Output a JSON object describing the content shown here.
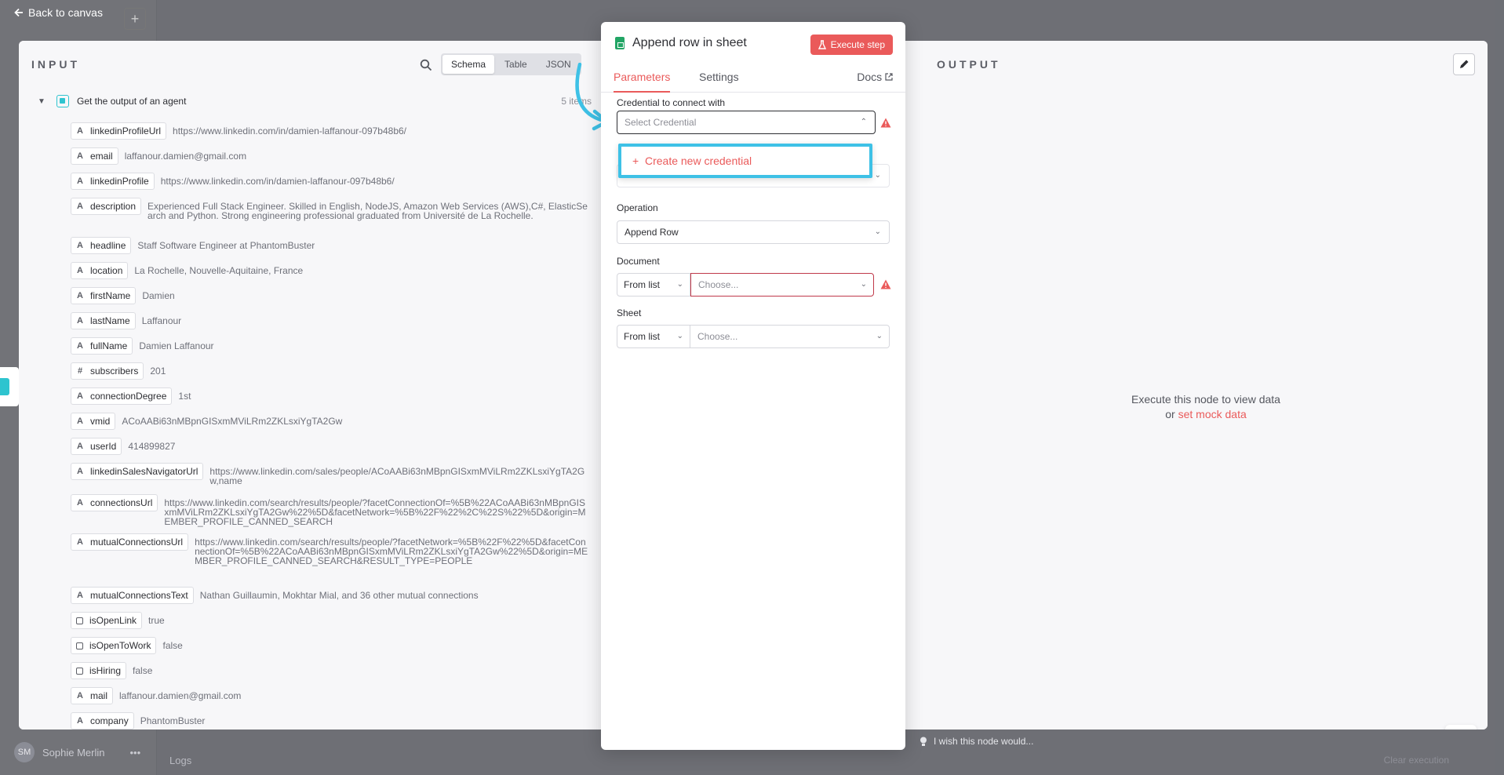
{
  "backdrop": {
    "back_label": "Back to canvas",
    "add_label": "+",
    "user_initials": "SM",
    "user_name": "Sophie Merlin",
    "user_menu": "•••",
    "logs_label": "Logs",
    "clear_label": "Clear execution",
    "wish_label": "I wish this node would..."
  },
  "input": {
    "title": "INPUT",
    "view_modes": [
      "Schema",
      "Table",
      "JSON"
    ],
    "active_mode": "Schema",
    "group_title": "Get the output of an agent",
    "group_count": "5 items",
    "fields": [
      {
        "type": "A",
        "key": "linkedinProfileUrl",
        "value": "https://www.linkedin.com/in/damien-laffanour-097b48b6/"
      },
      {
        "type": "A",
        "key": "email",
        "value": "laffanour.damien@gmail.com"
      },
      {
        "type": "A",
        "key": "linkedinProfile",
        "value": "https://www.linkedin.com/in/damien-laffanour-097b48b6/"
      },
      {
        "type": "A",
        "key": "description",
        "value": "Experienced Full Stack Engineer. Skilled in English, NodeJS, Amazon Web Services (AWS),C#, ElasticSearch and Python. Strong engineering professional graduated from Université de La Rochelle."
      },
      {
        "type": "A",
        "key": "headline",
        "value": "Staff Software Engineer at PhantomBuster"
      },
      {
        "type": "A",
        "key": "location",
        "value": "La Rochelle, Nouvelle-Aquitaine, France"
      },
      {
        "type": "A",
        "key": "firstName",
        "value": "Damien"
      },
      {
        "type": "A",
        "key": "lastName",
        "value": "Laffanour"
      },
      {
        "type": "A",
        "key": "fullName",
        "value": "Damien Laffanour"
      },
      {
        "type": "#",
        "key": "subscribers",
        "value": "201"
      },
      {
        "type": "A",
        "key": "connectionDegree",
        "value": "1st"
      },
      {
        "type": "A",
        "key": "vmid",
        "value": "ACoAABi63nMBpnGISxmMViLRm2ZKLsxiYgTA2Gw"
      },
      {
        "type": "A",
        "key": "userId",
        "value": "414899827"
      },
      {
        "type": "A",
        "key": "linkedinSalesNavigatorUrl",
        "value": "https://www.linkedin.com/sales/people/ACoAABi63nMBpnGISxmMViLRm2ZKLsxiYgTA2Gw,name"
      },
      {
        "type": "A",
        "key": "connectionsUrl",
        "value": "https://www.linkedin.com/search/results/people/?facetConnectionOf=%5B%22ACoAABi63nMBpnGISxmMViLRm2ZKLsxiYgTA2Gw%22%5D&facetNetwork=%5B%22F%22%2C%22S%22%5D&origin=MEMBER_PROFILE_CANNED_SEARCH"
      },
      {
        "type": "A",
        "key": "mutualConnectionsUrl",
        "value": "https://www.linkedin.com/search/results/people/?facetNetwork=%5B%22F%22%5D&facetConnectionOf=%5B%22ACoAABi63nMBpnGISxmMViLRm2ZKLsxiYgTA2Gw%22%5D&origin=MEMBER_PROFILE_CANNED_SEARCH&RESULT_TYPE=PEOPLE"
      },
      {
        "type": "A",
        "key": "mutualConnectionsText",
        "value": "Nathan Guillaumin, Mokhtar Mial, and 36 other mutual connections"
      },
      {
        "type": "check",
        "key": "isOpenLink",
        "value": "true"
      },
      {
        "type": "check",
        "key": "isOpenToWork",
        "value": "false"
      },
      {
        "type": "check",
        "key": "isHiring",
        "value": "false"
      },
      {
        "type": "A",
        "key": "mail",
        "value": "laffanour.damien@gmail.com"
      },
      {
        "type": "A",
        "key": "company",
        "value": "PhantomBuster"
      }
    ]
  },
  "node": {
    "title": "Append row in sheet",
    "execute_label": "Execute step",
    "tabs": [
      "Parameters",
      "Settings"
    ],
    "docs_label": "Docs",
    "credential_label": "Credential to connect with",
    "credential_placeholder": "Select Credential",
    "create_credential_label": "Create new credential",
    "operation_label": "Operation",
    "operation_value": "Append Row",
    "document_label": "Document",
    "document_mode": "From list",
    "document_placeholder": "Choose...",
    "sheet_label": "Sheet",
    "sheet_mode": "From list",
    "sheet_placeholder": "Choose..."
  },
  "output": {
    "title": "OUTPUT",
    "empty_line1": "Execute this node to view data",
    "empty_or": "or",
    "mock_link": "set mock data"
  },
  "colors": {
    "accent": "#ea5a5a",
    "highlight": "#3ec1e6",
    "sheets_green": "#22a565",
    "node_teal": "#2ec4cf"
  }
}
